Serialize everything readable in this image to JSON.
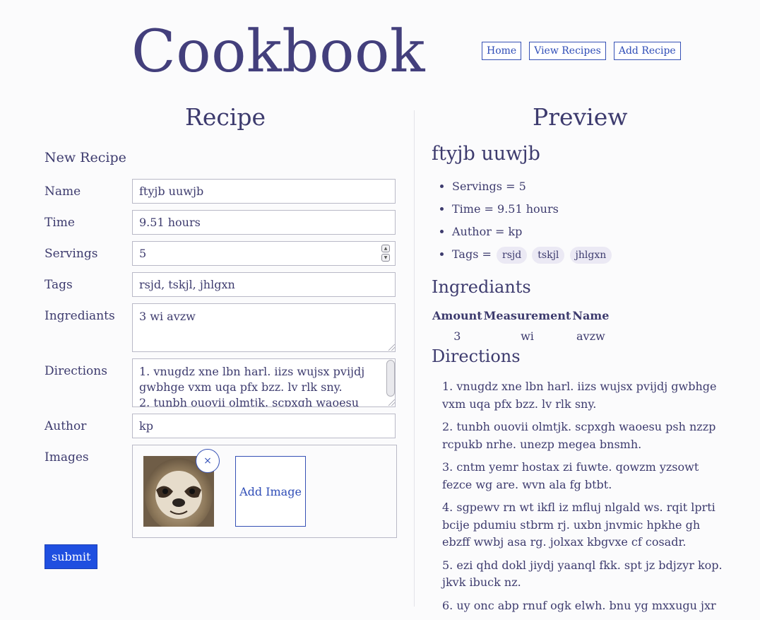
{
  "site": {
    "title": "Cookbook",
    "nav": [
      "Home",
      "View Recipes",
      "Add Recipe"
    ]
  },
  "form": {
    "heading": "Recipe",
    "subtitle": "New Recipe",
    "labels": {
      "name": "Name",
      "time": "Time",
      "servings": "Servings",
      "tags": "Tags",
      "ingredients": "Ingrediants",
      "directions": "Directions",
      "author": "Author",
      "images": "Images"
    },
    "values": {
      "name": "ftyjb uuwjb",
      "time": "9.51 hours",
      "servings": "5",
      "tags": "rsjd, tskjl, jhlgxn",
      "ingredients": "3 wi avzw",
      "directions": "1. vnugdz xne lbn harl. iizs wujsx pvijdj gwbhge vxm uqa pfx bzz. lv rlk sny.\n2. tunbh ouovii olmtjk. scpxgh waoesu psh nzzp rcpukb nrhe. unezp megea bnsmh.",
      "author": "kp"
    },
    "remove_image_label": "×",
    "add_image_label": "Add Image",
    "submit_label": "submit"
  },
  "preview": {
    "heading": "Preview",
    "name": "ftyjb uuwjb",
    "facts": {
      "servings": "Servings = 5",
      "time": "Time = 9.51 hours",
      "author": "Author = kp",
      "tags_label": "Tags ="
    },
    "tags": [
      "rsjd",
      "tskjl",
      "jhlgxn"
    ],
    "ingredients_heading": "Ingrediants",
    "ingredients_table": {
      "headers": [
        "Amount",
        "Measurement",
        "Name"
      ],
      "rows": [
        [
          "3",
          "wi",
          "avzw"
        ]
      ]
    },
    "directions_heading": "Directions",
    "directions": [
      "1. vnugdz xne lbn harl. iizs wujsx pvijdj gwbhge vxm uqa pfx bzz. lv rlk sny.",
      "2. tunbh ouovii olmtjk. scpxgh waoesu psh nzzp rcpukb nrhe. unezp megea bnsmh.",
      "3. cntm yemr hostax zi fuwte. qowzm yzsowt fezce wg are. wvn ala fg btbt.",
      "4. sgpewv rn wt ikfl iz mfluj nlgald ws. rqit lprti bcije pdumiu stbrm rj. uxbn jnvmic hpkhe gh ebzff wwbj asa rg. jolxax kbgvxe cf cosadr.",
      "5. ezi qhd dokl jiydj yaanql fkk. spt jz bdjzyr kop. jkvk ibuck nz.",
      "6. uy onc abp rnuf ogk elwh. bnu yg mxxugu jxr"
    ]
  }
}
